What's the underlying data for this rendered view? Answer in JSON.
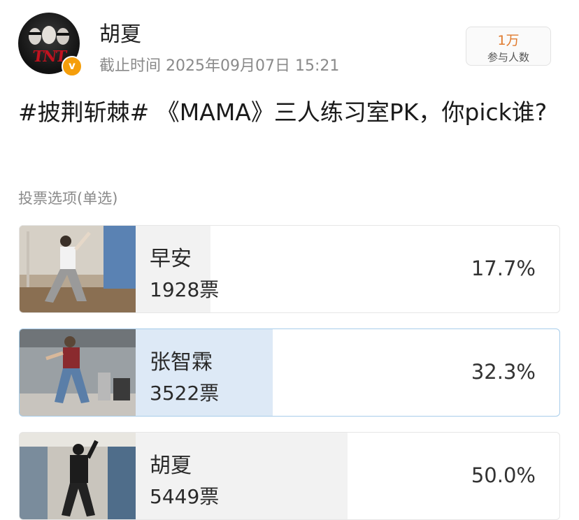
{
  "header": {
    "username": "胡夏",
    "deadline": "截止时间 2025年09月07日 15:21",
    "participants_count": "1万",
    "participants_label": "参与人数",
    "avatar_logo_text": "TNT"
  },
  "post": {
    "question": "#披荆斩棘# 《MAMA》三人练习室PK，你pick谁?"
  },
  "poll": {
    "type_label": "投票选项(单选)",
    "options": [
      {
        "name": "早安",
        "votes": "1928票",
        "percent_label": "17.7%",
        "percent": 17.7,
        "selected": false
      },
      {
        "name": "张智霖",
        "votes": "3522票",
        "percent_label": "32.3%",
        "percent": 32.3,
        "selected": true
      },
      {
        "name": "胡夏",
        "votes": "5449票",
        "percent_label": "50.0%",
        "percent": 50.0,
        "selected": false
      }
    ]
  },
  "colors": {
    "accent_orange": "#e07a2e",
    "verified_badge": "#f59e0b",
    "selected_border": "#a8cdea",
    "selected_fill": "#dde9f6",
    "default_fill": "#f2f2f2"
  }
}
